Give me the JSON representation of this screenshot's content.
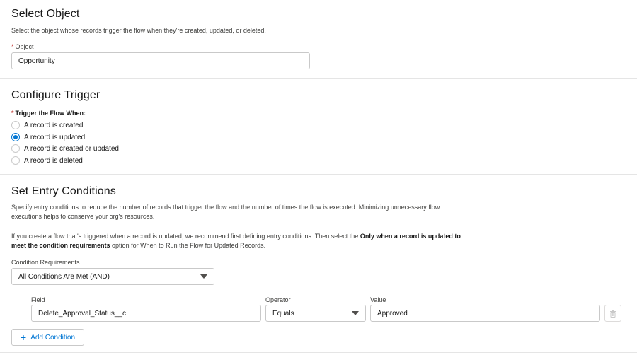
{
  "select_object": {
    "title": "Select Object",
    "description": "Select the object whose records trigger the flow when they're created, updated, or deleted.",
    "object_label": "Object",
    "object_value": "Opportunity"
  },
  "configure_trigger": {
    "title": "Configure Trigger",
    "trigger_label": "Trigger the Flow When:",
    "options": [
      {
        "label": "A record is created",
        "checked": false
      },
      {
        "label": "A record is updated",
        "checked": true
      },
      {
        "label": "A record is created or updated",
        "checked": false
      },
      {
        "label": "A record is deleted",
        "checked": false
      }
    ]
  },
  "entry_conditions": {
    "title": "Set Entry Conditions",
    "description_1a": "Specify entry conditions to reduce the number of records that trigger the flow and the number of times the flow is executed. Minimizing unnecessary flow",
    "description_1b": "executions helps to conserve your org's resources.",
    "description_2_prefix": "If you create a flow that's triggered when a record is updated, we recommend first defining entry conditions. Then select the",
    "description_2_bold_1": "Only when a record is updated to",
    "description_2_bold_2": "meet the condition requirements",
    "description_2_suffix": "option for When to Run the Flow for Updated Records.",
    "condition_requirements_label": "Condition Requirements",
    "condition_requirements_value": "All Conditions Are Met (AND)",
    "field_label": "Field",
    "operator_label": "Operator",
    "value_label": "Value",
    "field_value": "Delete_Approval_Status__c",
    "operator_value": "Equals",
    "value_value": "Approved",
    "add_condition_label": "Add Condition"
  }
}
